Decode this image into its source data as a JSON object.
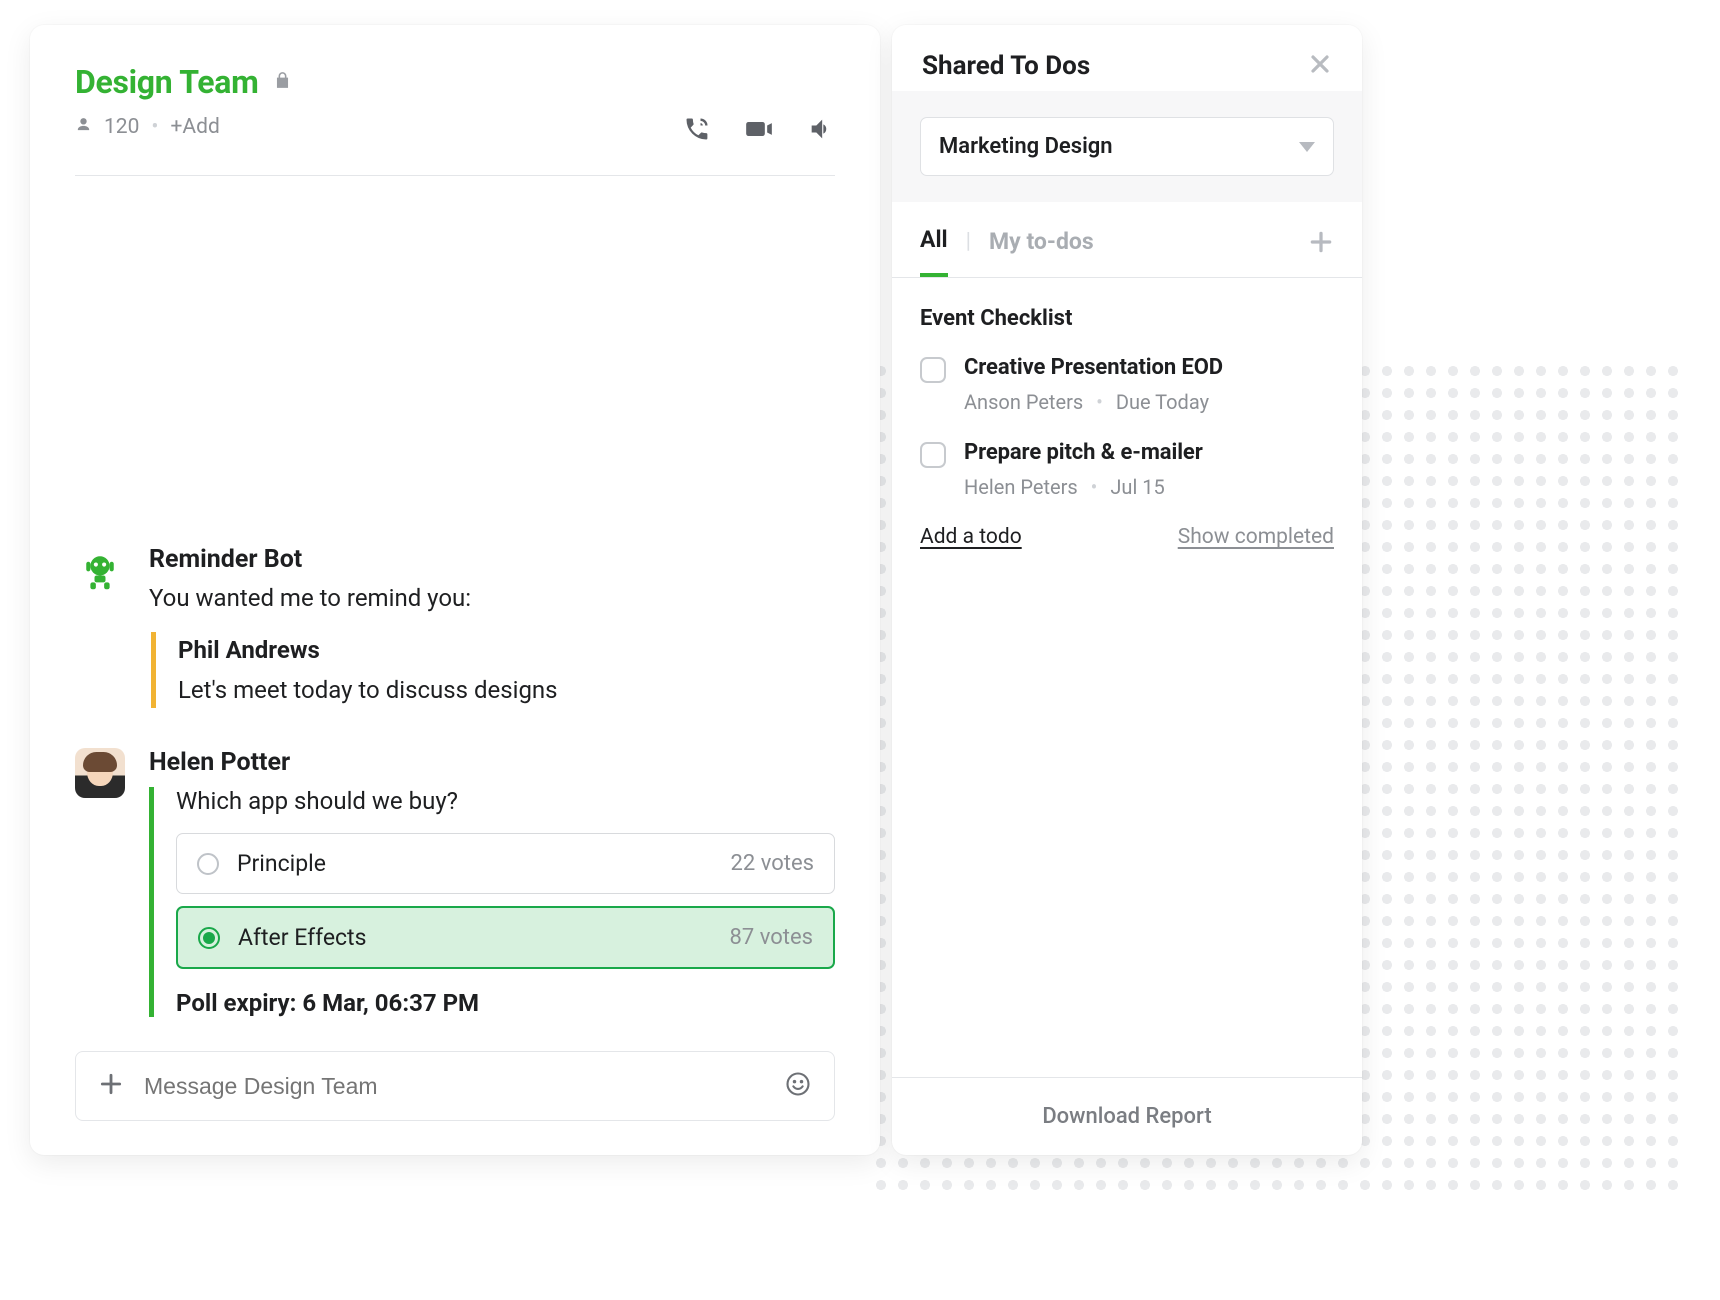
{
  "chat": {
    "title": "Design Team",
    "member_count": "120",
    "add_label": "+Add",
    "composer_placeholder": "Message Design Team"
  },
  "messages": {
    "bot": {
      "name": "Reminder Bot",
      "note": "You wanted me to remind you:",
      "quote_name": "Phil Andrews",
      "quote_text": "Let's meet today to discuss designs"
    },
    "poll": {
      "sender": "Helen Potter",
      "question": "Which app should we buy?",
      "options": [
        {
          "label": "Principle",
          "votes": "22 votes",
          "selected": false
        },
        {
          "label": "After Effects",
          "votes": "87 votes",
          "selected": true
        }
      ],
      "expiry": "Poll expiry: 6 Mar, 06:37 PM"
    }
  },
  "todos": {
    "panel_title": "Shared To Dos",
    "selector_value": "Marketing Design",
    "tabs": {
      "all": "All",
      "mine": "My to-dos"
    },
    "section": "Event Checklist",
    "items": [
      {
        "title": "Creative Presentation EOD",
        "owner": "Anson Peters",
        "due": "Due Today"
      },
      {
        "title": "Prepare pitch & e-mailer",
        "owner": "Helen Peters",
        "due": "Jul 15"
      }
    ],
    "add_label": "Add a todo",
    "show_completed": "Show completed",
    "footer": "Download Report"
  }
}
